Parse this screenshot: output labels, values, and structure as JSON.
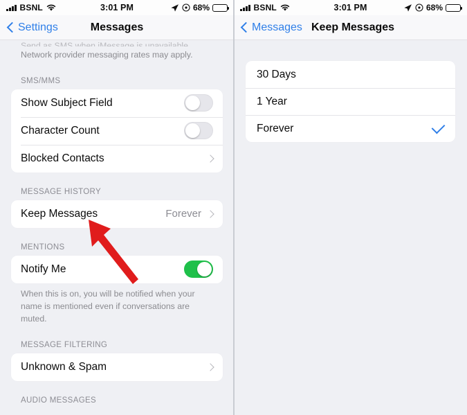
{
  "status_bar": {
    "carrier": "BSNL",
    "time": "3:01 PM",
    "battery_percent": "68%",
    "signal_icon": "signal-bars-icon",
    "wifi_icon": "wifi-icon",
    "location_icon": "location-arrow-icon",
    "alarm_icon": "alarm-circle-icon",
    "battery_icon": "battery-icon"
  },
  "left_panel": {
    "nav": {
      "back_label": "Settings",
      "title": "Messages"
    },
    "clipped_text": "Send as SMS when iMessage is unavailable.",
    "footnote_top": "Network provider messaging rates may apply.",
    "sections": [
      {
        "header": "SMS/MMS",
        "rows": [
          {
            "label": "Show Subject Field",
            "type": "toggle",
            "value": "off"
          },
          {
            "label": "Character Count",
            "type": "toggle",
            "value": "off"
          },
          {
            "label": "Blocked Contacts",
            "type": "disclosure",
            "value": ""
          }
        ]
      },
      {
        "header": "MESSAGE HISTORY",
        "rows": [
          {
            "label": "Keep Messages",
            "type": "disclosure",
            "value": "Forever"
          }
        ]
      },
      {
        "header": "MENTIONS",
        "rows": [
          {
            "label": "Notify Me",
            "type": "toggle",
            "value": "on"
          }
        ],
        "footnote": "When this is on, you will be notified when your name is mentioned even if conversations are muted."
      },
      {
        "header": "MESSAGE FILTERING",
        "rows": [
          {
            "label": "Unknown & Spam",
            "type": "disclosure",
            "value": ""
          }
        ]
      },
      {
        "header": "AUDIO MESSAGES",
        "rows": []
      }
    ],
    "annotation": {
      "type": "red-arrow",
      "color": "#e01c1c",
      "points_to": "Keep Messages"
    }
  },
  "right_panel": {
    "nav": {
      "back_label": "Messages",
      "title": "Keep Messages"
    },
    "options": [
      {
        "label": "30 Days",
        "selected": false
      },
      {
        "label": "1 Year",
        "selected": false
      },
      {
        "label": "Forever",
        "selected": true
      }
    ],
    "checkmark_color": "#2f7fe8"
  }
}
